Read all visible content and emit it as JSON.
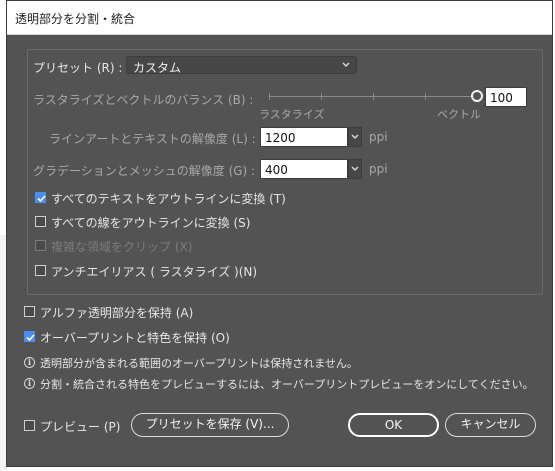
{
  "title": "透明部分を分割・統合",
  "preset": {
    "label": "プリセット (R) :",
    "value": "カスタム"
  },
  "balance": {
    "label": "ラスタライズとベクトルのバランス (B) :",
    "min_label": "ラスタライズ",
    "max_label": "ベクトル",
    "value": "100",
    "level": 100
  },
  "line_art": {
    "label": "ラインアートとテキストの解像度 (L) :",
    "value": "1200",
    "unit": "ppi"
  },
  "gradient": {
    "label": "グラデーションとメッシュの解像度 (G) :",
    "value": "400",
    "unit": "ppi"
  },
  "options": {
    "text_outline": {
      "label": "すべてのテキストをアウトラインに変換 (T)",
      "checked": true
    },
    "stroke_outline": {
      "label": "すべての線をアウトラインに変換 (S)",
      "checked": false
    },
    "clip_complex": {
      "label": "複雑な領域をクリップ (X)",
      "checked": false,
      "disabled": true
    },
    "antialias": {
      "label": "アンチエイリアス ( ラスタライズ )(N)",
      "checked": false
    }
  },
  "preserve_alpha": {
    "label": "アルファ透明部分を保持 (A)",
    "checked": false
  },
  "overprint": {
    "label": "オーバープリントと特色を保持 (O)",
    "checked": true
  },
  "info1": "透明部分が含まれる範囲のオーバープリントは保持されません。",
  "info2": "分割・統合される特色をプレビューするには、オーバープリントプレビューをオンにしてください。",
  "preview": {
    "label": "プレビュー (P)",
    "checked": false
  },
  "buttons": {
    "save_preset": "プリセットを保存 (V)...",
    "ok": "OK",
    "cancel": "キャンセル"
  },
  "colors": {
    "dialog_bg": "#535353",
    "accent": "#4b8ef2"
  }
}
